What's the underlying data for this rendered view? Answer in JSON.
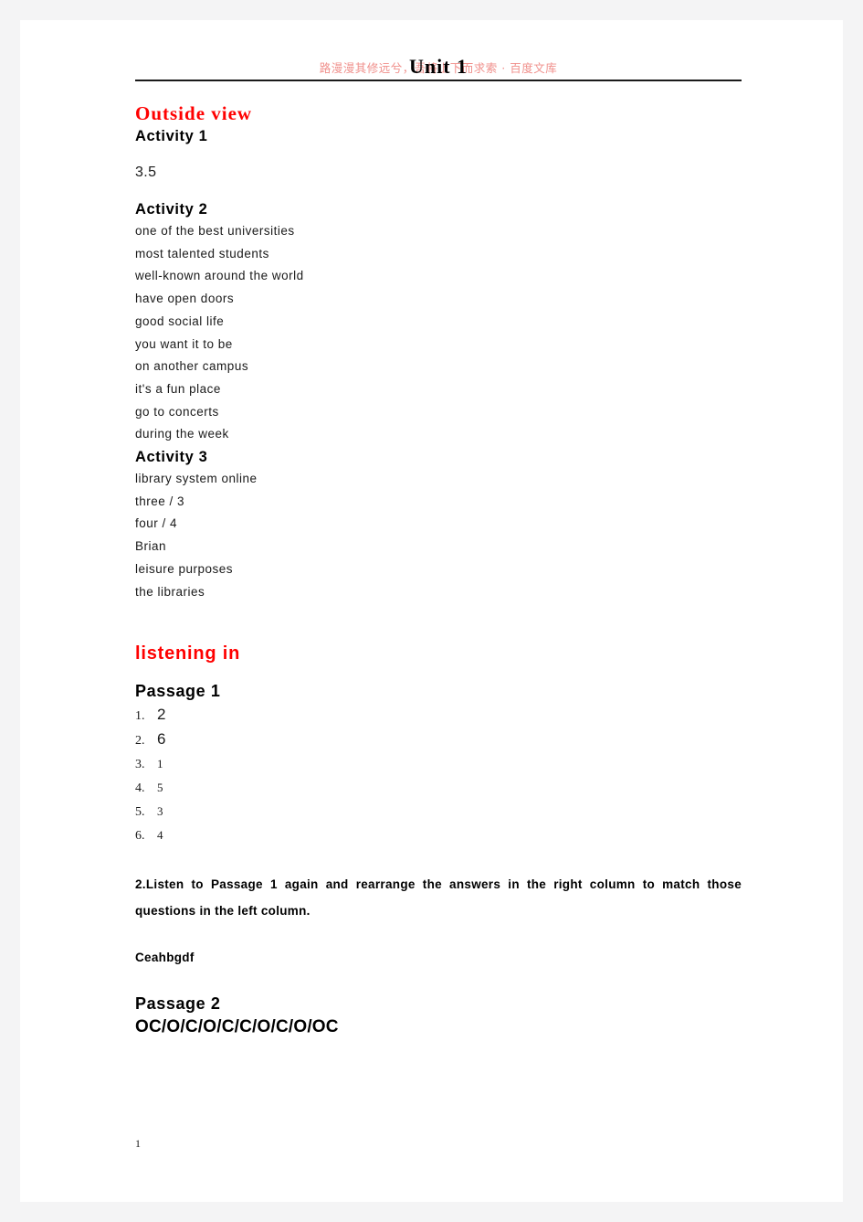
{
  "header": {
    "watermark": "路漫漫其修远兮，吾将上下而求索 · 百度文库",
    "watermark_color": "#f0908c"
  },
  "document": {
    "title": "Unit  1",
    "page_number": "1"
  },
  "sections": [
    {
      "heading": "Outside  view",
      "heading_color": "#ff0000",
      "activities": [
        {
          "label": "Activity  1",
          "items": [
            "3.5"
          ]
        },
        {
          "label": "Activity  2",
          "items": [
            "one  of  the  best  universities",
            "most  talented  students",
            "well-known  around  the  world",
            "have  open  doors",
            "good  social  life",
            "you  want  it  to  be",
            "on  another  campus",
            "it's  a  fun  place",
            "go  to  concerts",
            "during  the  week"
          ]
        },
        {
          "label": "Activity  3",
          "items": [
            "library  system  online",
            "three  /  3",
            "four  /  4",
            "Brian",
            "leisure  purposes",
            "the  libraries"
          ]
        }
      ]
    },
    {
      "heading": "listening  in",
      "heading_color": "#ff0000",
      "passage1_label": "Passage  1",
      "passage1_answers": [
        {
          "num": "1.",
          "value": "2"
        },
        {
          "num": "2.",
          "value": "6"
        },
        {
          "num": "3.",
          "value": "1"
        },
        {
          "num": "4.",
          "value": "5"
        },
        {
          "num": "5.",
          "value": "3"
        },
        {
          "num": "6.",
          "value": "4"
        }
      ],
      "instruction": "2.Listen to Passage 1 again and rearrange the answers in the right column to match those questions in the left column.",
      "matching_answer": "Ceahbgdf",
      "passage2_label": "Passage  2",
      "passage2_answer": "OC/O/C/O/C/C/O/C/O/OC"
    }
  ]
}
